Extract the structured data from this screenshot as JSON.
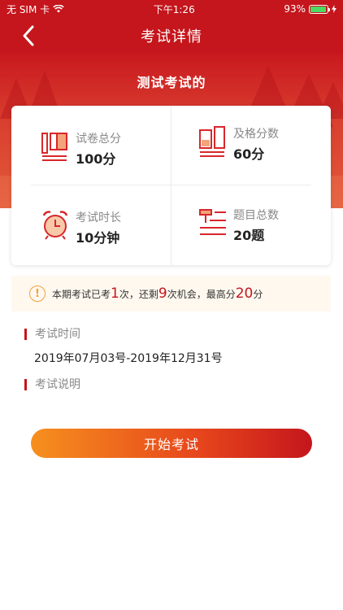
{
  "status_bar": {
    "carrier": "无 SIM 卡",
    "time": "下午1:26",
    "battery_percent_text": "93%",
    "battery_level": 0.93
  },
  "nav": {
    "title": "考试详情",
    "back_icon": "chevron-left-icon"
  },
  "exam": {
    "name": "测试考试的"
  },
  "stats": [
    {
      "label": "试卷总分",
      "value": "100分",
      "icon": "paper-icon"
    },
    {
      "label": "及格分数",
      "value": "60分",
      "icon": "pass-score-icon"
    },
    {
      "label": "考试时长",
      "value": "10分钟",
      "icon": "alarm-clock-icon"
    },
    {
      "label": "题目总数",
      "value": "20题",
      "icon": "question-list-icon"
    }
  ],
  "notice": {
    "icon": "exclamation-icon",
    "prefix": "本期考试已考",
    "taken": "1",
    "mid1": "次，还剩",
    "remaining": "9",
    "mid2": "次机会，最高分",
    "best": "20",
    "suffix": "分"
  },
  "sections": {
    "time_label": "考试时间",
    "time_value": "2019年07月03号-2019年12月31号",
    "desc_label": "考试说明"
  },
  "actions": {
    "start_label": "开始考试"
  },
  "colors": {
    "brand_red": "#c4161c",
    "accent_orange": "#f6901e",
    "notice_bg": "#fff8ef"
  }
}
